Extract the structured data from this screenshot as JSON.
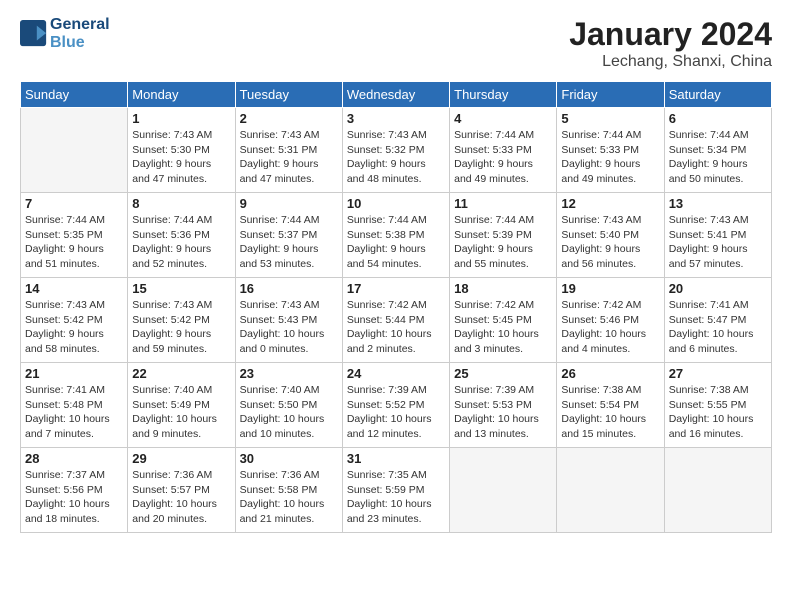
{
  "header": {
    "logo_line1": "General",
    "logo_line2": "Blue",
    "title": "January 2024",
    "subtitle": "Lechang, Shanxi, China"
  },
  "days_of_week": [
    "Sunday",
    "Monday",
    "Tuesday",
    "Wednesday",
    "Thursday",
    "Friday",
    "Saturday"
  ],
  "weeks": [
    [
      {
        "day": "",
        "info": ""
      },
      {
        "day": "1",
        "info": "Sunrise: 7:43 AM\nSunset: 5:30 PM\nDaylight: 9 hours\nand 47 minutes."
      },
      {
        "day": "2",
        "info": "Sunrise: 7:43 AM\nSunset: 5:31 PM\nDaylight: 9 hours\nand 47 minutes."
      },
      {
        "day": "3",
        "info": "Sunrise: 7:43 AM\nSunset: 5:32 PM\nDaylight: 9 hours\nand 48 minutes."
      },
      {
        "day": "4",
        "info": "Sunrise: 7:44 AM\nSunset: 5:33 PM\nDaylight: 9 hours\nand 49 minutes."
      },
      {
        "day": "5",
        "info": "Sunrise: 7:44 AM\nSunset: 5:33 PM\nDaylight: 9 hours\nand 49 minutes."
      },
      {
        "day": "6",
        "info": "Sunrise: 7:44 AM\nSunset: 5:34 PM\nDaylight: 9 hours\nand 50 minutes."
      }
    ],
    [
      {
        "day": "7",
        "info": "Sunrise: 7:44 AM\nSunset: 5:35 PM\nDaylight: 9 hours\nand 51 minutes."
      },
      {
        "day": "8",
        "info": "Sunrise: 7:44 AM\nSunset: 5:36 PM\nDaylight: 9 hours\nand 52 minutes."
      },
      {
        "day": "9",
        "info": "Sunrise: 7:44 AM\nSunset: 5:37 PM\nDaylight: 9 hours\nand 53 minutes."
      },
      {
        "day": "10",
        "info": "Sunrise: 7:44 AM\nSunset: 5:38 PM\nDaylight: 9 hours\nand 54 minutes."
      },
      {
        "day": "11",
        "info": "Sunrise: 7:44 AM\nSunset: 5:39 PM\nDaylight: 9 hours\nand 55 minutes."
      },
      {
        "day": "12",
        "info": "Sunrise: 7:43 AM\nSunset: 5:40 PM\nDaylight: 9 hours\nand 56 minutes."
      },
      {
        "day": "13",
        "info": "Sunrise: 7:43 AM\nSunset: 5:41 PM\nDaylight: 9 hours\nand 57 minutes."
      }
    ],
    [
      {
        "day": "14",
        "info": "Sunrise: 7:43 AM\nSunset: 5:42 PM\nDaylight: 9 hours\nand 58 minutes."
      },
      {
        "day": "15",
        "info": "Sunrise: 7:43 AM\nSunset: 5:42 PM\nDaylight: 9 hours\nand 59 minutes."
      },
      {
        "day": "16",
        "info": "Sunrise: 7:43 AM\nSunset: 5:43 PM\nDaylight: 10 hours\nand 0 minutes."
      },
      {
        "day": "17",
        "info": "Sunrise: 7:42 AM\nSunset: 5:44 PM\nDaylight: 10 hours\nand 2 minutes."
      },
      {
        "day": "18",
        "info": "Sunrise: 7:42 AM\nSunset: 5:45 PM\nDaylight: 10 hours\nand 3 minutes."
      },
      {
        "day": "19",
        "info": "Sunrise: 7:42 AM\nSunset: 5:46 PM\nDaylight: 10 hours\nand 4 minutes."
      },
      {
        "day": "20",
        "info": "Sunrise: 7:41 AM\nSunset: 5:47 PM\nDaylight: 10 hours\nand 6 minutes."
      }
    ],
    [
      {
        "day": "21",
        "info": "Sunrise: 7:41 AM\nSunset: 5:48 PM\nDaylight: 10 hours\nand 7 minutes."
      },
      {
        "day": "22",
        "info": "Sunrise: 7:40 AM\nSunset: 5:49 PM\nDaylight: 10 hours\nand 9 minutes."
      },
      {
        "day": "23",
        "info": "Sunrise: 7:40 AM\nSunset: 5:50 PM\nDaylight: 10 hours\nand 10 minutes."
      },
      {
        "day": "24",
        "info": "Sunrise: 7:39 AM\nSunset: 5:52 PM\nDaylight: 10 hours\nand 12 minutes."
      },
      {
        "day": "25",
        "info": "Sunrise: 7:39 AM\nSunset: 5:53 PM\nDaylight: 10 hours\nand 13 minutes."
      },
      {
        "day": "26",
        "info": "Sunrise: 7:38 AM\nSunset: 5:54 PM\nDaylight: 10 hours\nand 15 minutes."
      },
      {
        "day": "27",
        "info": "Sunrise: 7:38 AM\nSunset: 5:55 PM\nDaylight: 10 hours\nand 16 minutes."
      }
    ],
    [
      {
        "day": "28",
        "info": "Sunrise: 7:37 AM\nSunset: 5:56 PM\nDaylight: 10 hours\nand 18 minutes."
      },
      {
        "day": "29",
        "info": "Sunrise: 7:36 AM\nSunset: 5:57 PM\nDaylight: 10 hours\nand 20 minutes."
      },
      {
        "day": "30",
        "info": "Sunrise: 7:36 AM\nSunset: 5:58 PM\nDaylight: 10 hours\nand 21 minutes."
      },
      {
        "day": "31",
        "info": "Sunrise: 7:35 AM\nSunset: 5:59 PM\nDaylight: 10 hours\nand 23 minutes."
      },
      {
        "day": "",
        "info": ""
      },
      {
        "day": "",
        "info": ""
      },
      {
        "day": "",
        "info": ""
      }
    ]
  ]
}
